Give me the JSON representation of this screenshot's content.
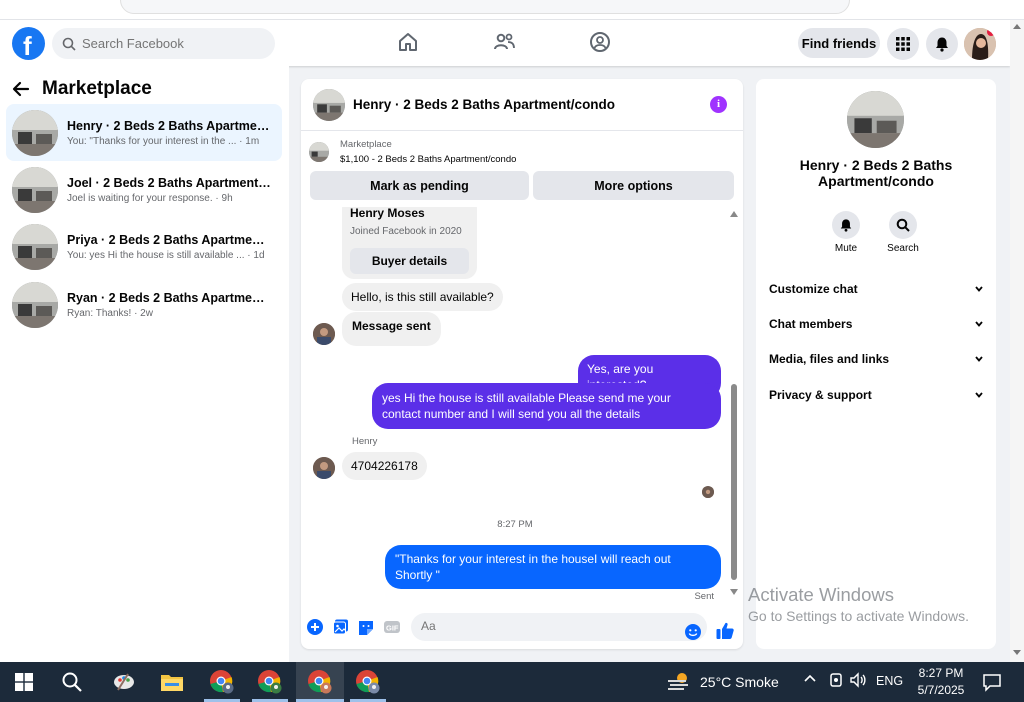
{
  "topbar": {
    "search_placeholder": "Search Facebook",
    "find_friends": "Find friends"
  },
  "left": {
    "title": "Marketplace",
    "conversations": [
      {
        "name": "Henry · 2 Beds 2 Baths Apartment...",
        "preview": "You: \"Thanks for your interest in the ... · 1m"
      },
      {
        "name": "Joel · 2 Beds 2 Baths Apartment/c...",
        "preview": "Joel is waiting for your response. · 9h"
      },
      {
        "name": "Priya · 2 Beds 2 Baths Apartment/c...",
        "preview": "You: yes Hi the house is still available ... · 1d"
      },
      {
        "name": "Ryan · 2 Beds 2 Baths Apartment/c...",
        "preview": "Ryan: Thanks! · 2w"
      }
    ]
  },
  "chat": {
    "title": "Henry · 2 Beds 2 Baths Apartment/condo",
    "marketplace_label": "Marketplace",
    "listing": "$1,100 - 2 Beds 2 Baths Apartment/condo",
    "mark_pending": "Mark as pending",
    "more_options": "More options",
    "buyer_name": "Henry Moses",
    "buyer_joined": "Joined Facebook in 2020",
    "buyer_details": "Buyer details",
    "msg1": "Hello, is this still available?",
    "msg2": "Message sent",
    "msg3": "Yes, are you interested?",
    "msg4": "yes Hi the house is still available Please send me your contact number and I will send you all the details",
    "sender_label": "Henry",
    "msg5": "4704226178",
    "time": "8:27 PM",
    "msg6": "\"Thanks for your interest in the houseI will reach out Shortly \"",
    "status": "Sent",
    "composer_placeholder": "Aa"
  },
  "right": {
    "name": "Henry · 2 Beds 2 Baths Apartment/condo",
    "mute": "Mute",
    "search": "Search",
    "items": [
      "Customize chat",
      "Chat members",
      "Media, files and links",
      "Privacy & support"
    ]
  },
  "watermark": {
    "line1": "Activate Windows",
    "line2": "Go to Settings to activate Windows."
  },
  "taskbar": {
    "weather": "25°C  Smoke",
    "lang": "ENG",
    "time": "8:27 PM",
    "date": "5/7/2025"
  },
  "colors": {
    "brand": "#1877f2",
    "outgoing_purple": "#5b2fe8",
    "outgoing_blue": "#0866ff",
    "taskbar": "#1c2a3a"
  }
}
